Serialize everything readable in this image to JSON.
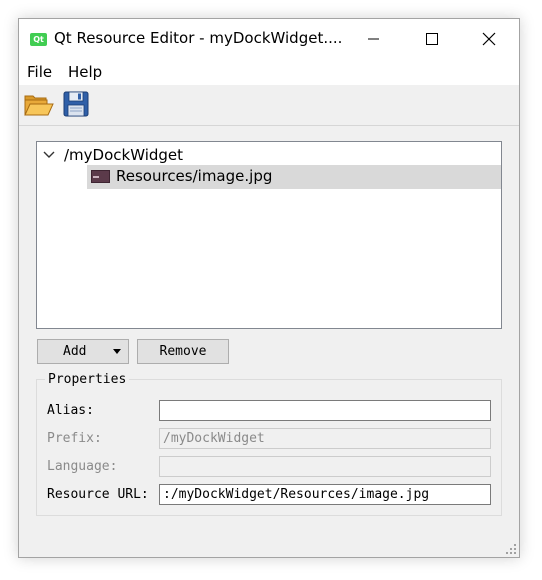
{
  "window": {
    "app_icon_text": "Qt",
    "title": "Qt Resource Editor - myDockWidget...."
  },
  "menu": {
    "items": [
      {
        "label": "File"
      },
      {
        "label": "Help"
      }
    ]
  },
  "toolbar": {
    "buttons": [
      {
        "icon": "folder-open-icon"
      },
      {
        "icon": "floppy-save-icon"
      }
    ]
  },
  "tree": {
    "root": {
      "label": "/myDockWidget",
      "expanded": true
    },
    "children": [
      {
        "label": "Resources/image.jpg",
        "icon": "image-file-icon",
        "selected": true
      }
    ]
  },
  "buttons": {
    "add_label": "Add",
    "remove_label": "Remove"
  },
  "properties": {
    "group_title": "Properties",
    "alias": {
      "label": "Alias:",
      "value": ""
    },
    "prefix": {
      "label": "Prefix:",
      "value": "/myDockWidget"
    },
    "language": {
      "label": "Language:",
      "value": ""
    },
    "resource_url": {
      "label": "Resource URL:",
      "value": ":/myDockWidget/Resources/image.jpg"
    }
  },
  "colors": {
    "window_bg": "#f0f0f0",
    "selection_bg": "#d9d9d9",
    "qt_green": "#41cd52"
  }
}
